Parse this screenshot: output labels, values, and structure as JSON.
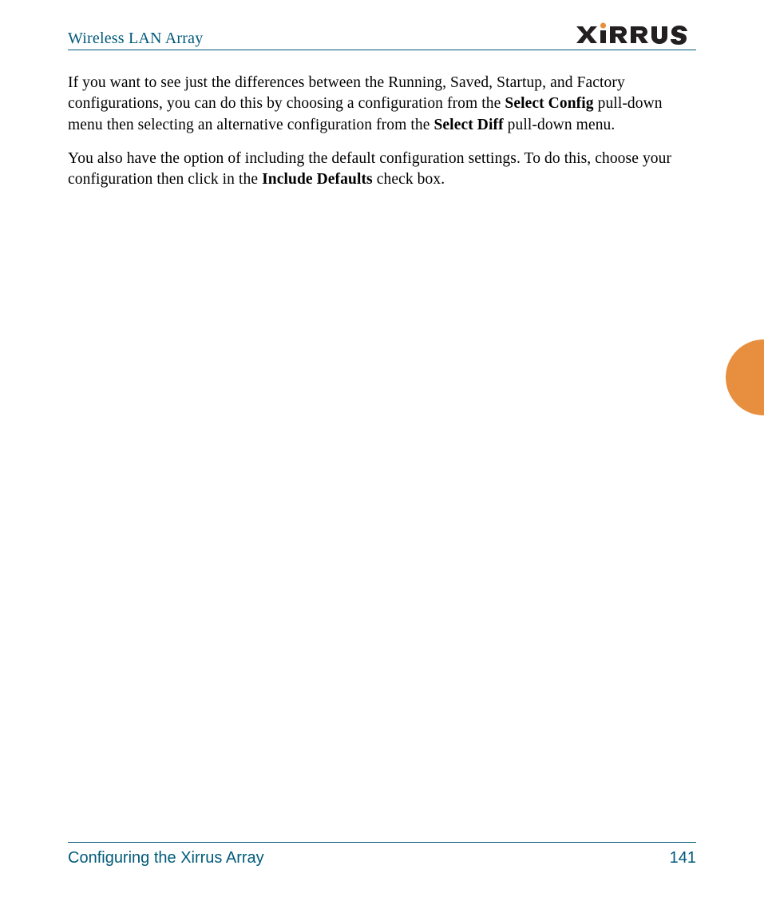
{
  "header": {
    "title": "Wireless LAN Array",
    "logo_text": "XIRRUS"
  },
  "body": {
    "para1_pre": "If you want to see just the differences between the Running, Saved, Startup, and Factory configurations, you can do this by choosing a configuration from the ",
    "para1_bold1": "Select Config",
    "para1_mid": " pull-down menu then selecting an alternative configuration from the ",
    "para1_bold2": "Select Diff",
    "para1_post": " pull-down menu.",
    "para2_pre": "You also have the option of including the default configuration settings. To do this, choose your configuration then click in the ",
    "para2_bold": "Include Defaults",
    "para2_post": " check box."
  },
  "footer": {
    "section": "Configuring the Xirrus Array",
    "page_number": "141"
  },
  "colors": {
    "brand_teal": "#015a7a",
    "accent_orange": "#e78f3f"
  }
}
